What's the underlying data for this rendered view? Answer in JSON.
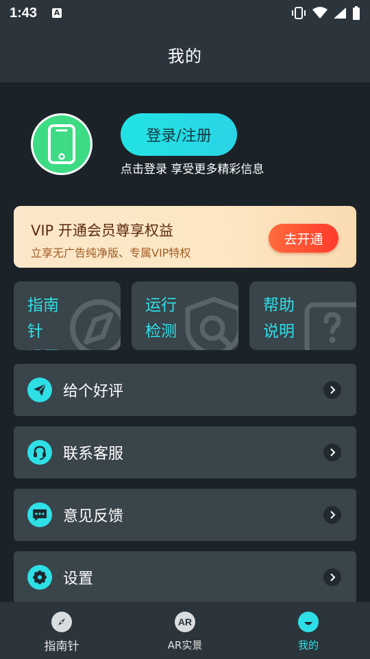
{
  "status_bar": {
    "time": "1:43"
  },
  "header": {
    "title": "我的"
  },
  "profile": {
    "login_label": "登录/注册",
    "hint": "点击登录 享受更多精彩信息"
  },
  "vip": {
    "title": "VIP 开通会员尊享权益",
    "subtitle": "立享无广告纯净版、专属VIP特权",
    "button": "去开通"
  },
  "tools": [
    {
      "line1": "指南针",
      "line2": "设置"
    },
    {
      "line1": "运行",
      "line2": "检测"
    },
    {
      "line1": "帮助",
      "line2": "说明"
    }
  ],
  "menu": [
    {
      "label": "给个好评",
      "icon": "send-icon"
    },
    {
      "label": "联系客服",
      "icon": "headset-icon"
    },
    {
      "label": "意见反馈",
      "icon": "chat-icon"
    },
    {
      "label": "设置",
      "icon": "gear-icon"
    }
  ],
  "bottom_nav": {
    "items": [
      {
        "label": "指南针",
        "icon": "compass-icon",
        "active": false
      },
      {
        "label": "AR实景",
        "icon": "ar-icon",
        "icon_text": "AR",
        "active": false
      },
      {
        "label": "我的",
        "icon": "smile-icon",
        "active": true
      }
    ]
  },
  "colors": {
    "accent": "#2ee0e6",
    "background": "#1b2329",
    "card": "#3a444b",
    "bar": "#2c353c",
    "vip_button": "#ff4a30"
  }
}
